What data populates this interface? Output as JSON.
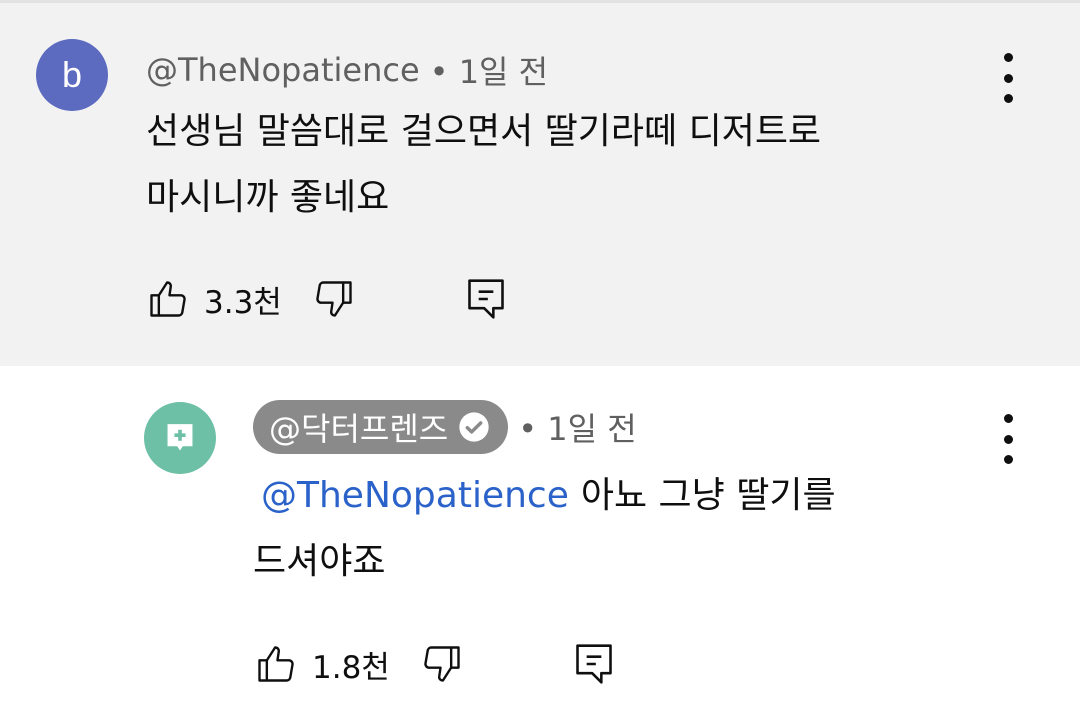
{
  "comment": {
    "avatar_letter": "b",
    "author": "@TheNopatience",
    "time": "• 1일 전",
    "text_line1": "선생님 말씀대로 걸으면서 딸기라떼 디저트로",
    "text_line2": "마시니까 좋네요",
    "likes": "3.3천",
    "avatar_color": "#5c6bc0"
  },
  "reply": {
    "author": "@닥터프렌즈",
    "time": "• 1일 전",
    "mention": "@TheNopatience",
    "text_line1": "아뇨 그냥 딸기를",
    "text_line2": "드셔야죠",
    "likes": "1.8천",
    "avatar_color": "#6dc0a6",
    "mention_color": "#2a62c9"
  },
  "icons": [
    "thumbs-up-icon",
    "thumbs-down-icon",
    "reply-icon",
    "more-vert-icon",
    "verified-icon",
    "medical-plus-icon"
  ]
}
